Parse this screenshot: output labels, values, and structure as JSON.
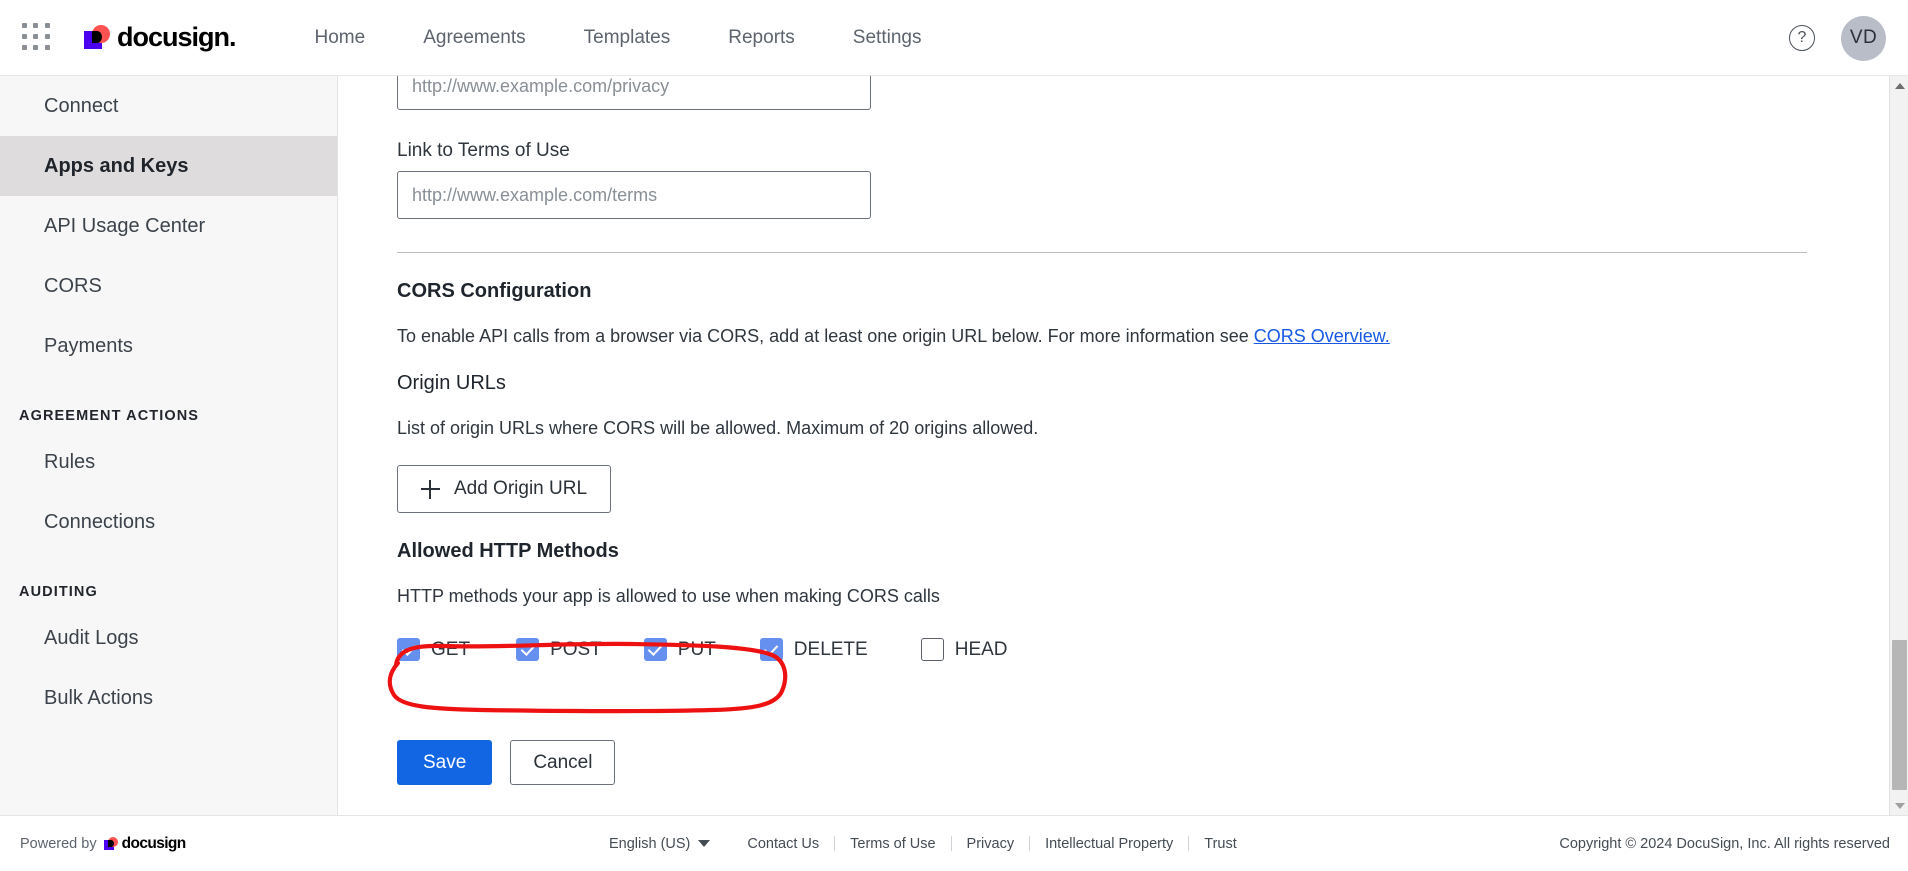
{
  "topnav": {
    "apps_icon": "grid-apps-icon",
    "brand": "docusign",
    "links": [
      "Home",
      "Agreements",
      "Templates",
      "Reports",
      "Settings"
    ],
    "help_icon": "?",
    "avatar_initials": "VD"
  },
  "sidebar": {
    "items": [
      {
        "label": "Connect",
        "type": "item",
        "active": false
      },
      {
        "label": "Apps and Keys",
        "type": "item",
        "active": true
      },
      {
        "label": "API Usage Center",
        "type": "item",
        "active": false
      },
      {
        "label": "CORS",
        "type": "item",
        "active": false
      },
      {
        "label": "Payments",
        "type": "item",
        "active": false
      },
      {
        "label": "AGREEMENT ACTIONS",
        "type": "group"
      },
      {
        "label": "Rules",
        "type": "item",
        "active": false
      },
      {
        "label": "Connections",
        "type": "item",
        "active": false
      },
      {
        "label": "AUDITING",
        "type": "group"
      },
      {
        "label": "Audit Logs",
        "type": "item",
        "active": false
      },
      {
        "label": "Bulk Actions",
        "type": "item",
        "active": false
      }
    ]
  },
  "main": {
    "privacy_input": {
      "value": "",
      "placeholder": "http://www.example.com/privacy"
    },
    "terms_label": "Link to Terms of Use",
    "terms_input": {
      "value": "",
      "placeholder": "http://www.example.com/terms"
    },
    "cors_section_title": "CORS Configuration",
    "cors_note_pre": "To enable API calls from a browser via CORS, add at least one origin URL below. For more information see ",
    "cors_note_link": "CORS Overview.",
    "origin_urls_title": "Origin URLs",
    "origin_urls_note": "List of origin URLs where CORS will be allowed. Maximum of 20 origins allowed.",
    "add_origin_button": "Add Origin URL",
    "methods_title": "Allowed HTTP Methods",
    "methods_note": "HTTP methods your app is allowed to use when making CORS calls",
    "methods": [
      {
        "label": "GET",
        "checked": true
      },
      {
        "label": "POST",
        "checked": true
      },
      {
        "label": "PUT",
        "checked": true
      },
      {
        "label": "DELETE",
        "checked": true
      },
      {
        "label": "HEAD",
        "checked": false
      }
    ],
    "save_button": "Save",
    "cancel_button": "Cancel"
  },
  "annotation": {
    "shape": "hand-drawn-red-ellipse",
    "color": "#ee1111",
    "encircles": "GET POST PUT DELETE checkboxes"
  },
  "footer": {
    "powered_by": "Powered by",
    "brand": "docusign",
    "language": "English (US)",
    "links": [
      "Contact Us",
      "Terms of Use",
      "Privacy",
      "Intellectual Property",
      "Trust"
    ],
    "copyright": "Copyright © 2024 DocuSign, Inc. All rights reserved"
  },
  "colors": {
    "accent_blue": "#1266e3",
    "checkbox_blue": "#6690f0",
    "link_blue": "#1759e3",
    "annotation_red": "#ee1111",
    "sidebar_bg": "#f7f7f7",
    "sidebar_active": "#dedcdd"
  }
}
